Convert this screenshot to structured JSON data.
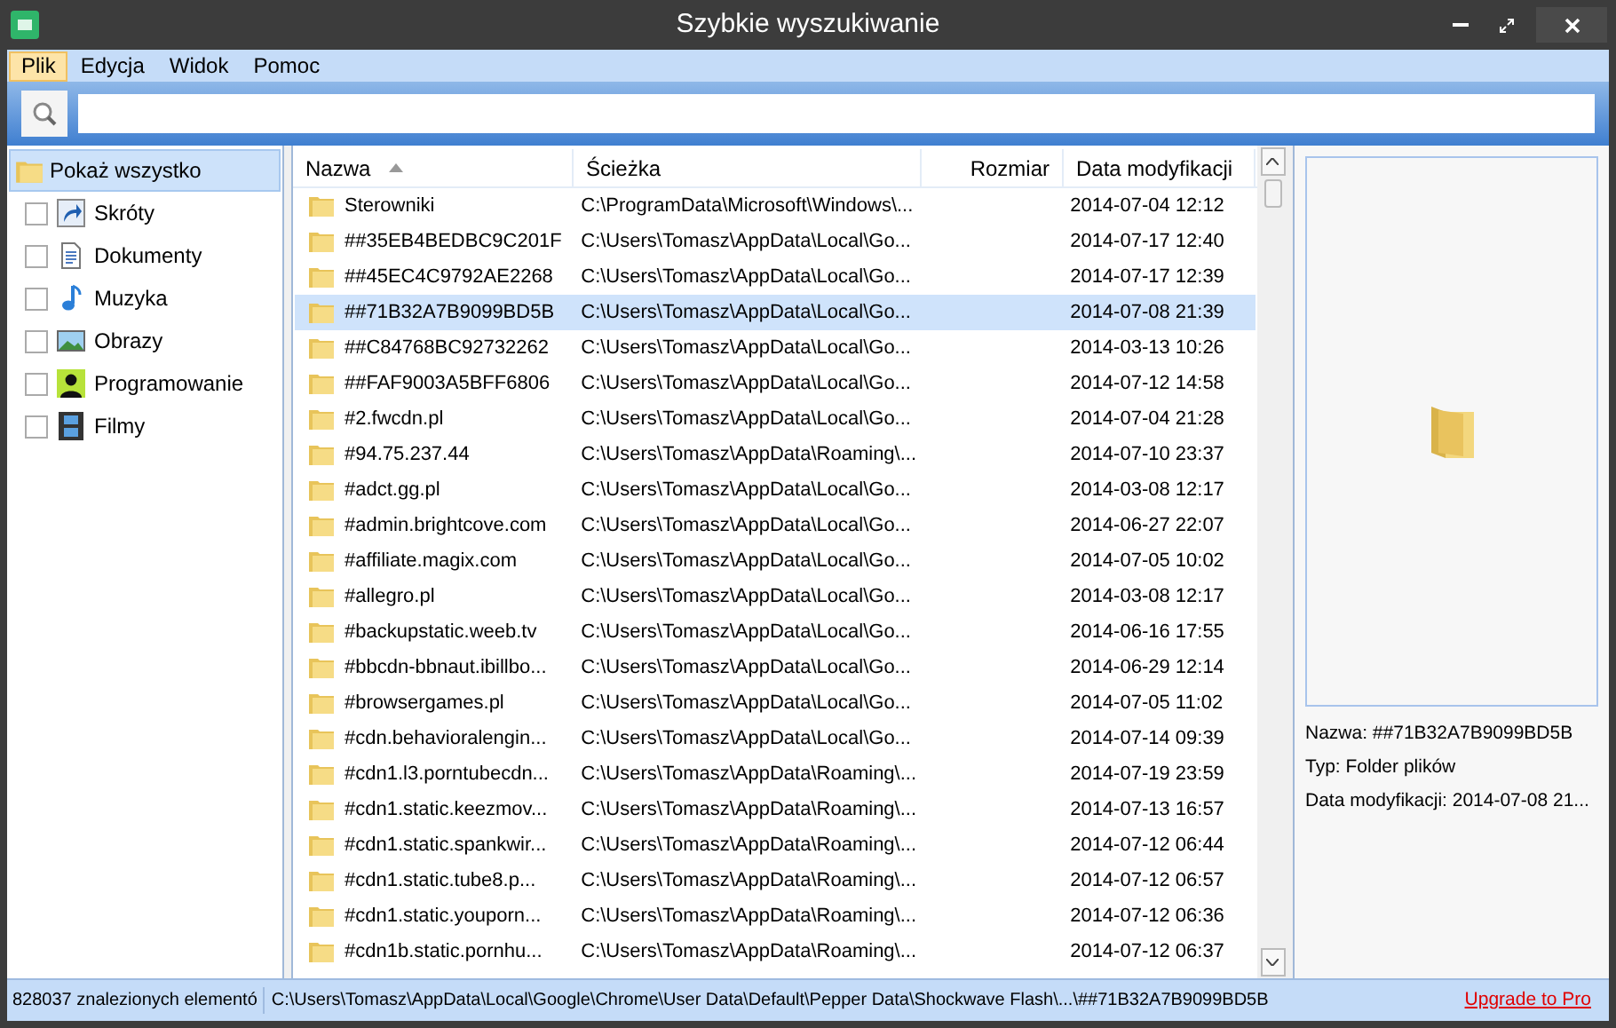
{
  "window": {
    "title": "Szybkie wyszukiwanie"
  },
  "menu": [
    {
      "label": "Plik",
      "selected": true
    },
    {
      "label": "Edycja",
      "selected": false
    },
    {
      "label": "Widok",
      "selected": false
    },
    {
      "label": "Pomoc",
      "selected": false
    }
  ],
  "sidebar": {
    "show_all": {
      "label": "Pokaż wszystko",
      "selected": true
    },
    "filters": [
      {
        "label": "Skróty",
        "checked": false
      },
      {
        "label": "Dokumenty",
        "checked": false
      },
      {
        "label": "Muzyka",
        "checked": false
      },
      {
        "label": "Obrazy",
        "checked": false
      },
      {
        "label": "Programowanie",
        "checked": false
      },
      {
        "label": "Filmy",
        "checked": false
      }
    ]
  },
  "table": {
    "columns": [
      "Nazwa",
      "Ścieżka",
      "Rozmiar",
      "Data modyfikacji"
    ],
    "rows": [
      {
        "name": "Sterowniki",
        "path": "C:\\ProgramData\\Microsoft\\Windows\\...",
        "date": "2014-07-04 12:12",
        "selected": false
      },
      {
        "name": "##35EB4BEDBC9C201F",
        "path": "C:\\Users\\Tomasz\\AppData\\Local\\Go...",
        "date": "2014-07-17 12:40",
        "selected": false
      },
      {
        "name": "##45EC4C9792AE2268",
        "path": "C:\\Users\\Tomasz\\AppData\\Local\\Go...",
        "date": "2014-07-17 12:39",
        "selected": false
      },
      {
        "name": "##71B32A7B9099BD5B",
        "path": "C:\\Users\\Tomasz\\AppData\\Local\\Go...",
        "date": "2014-07-08 21:39",
        "selected": true
      },
      {
        "name": "##C84768BC92732262",
        "path": "C:\\Users\\Tomasz\\AppData\\Local\\Go...",
        "date": "2014-03-13 10:26",
        "selected": false
      },
      {
        "name": "##FAF9003A5BFF6806",
        "path": "C:\\Users\\Tomasz\\AppData\\Local\\Go...",
        "date": "2014-07-12 14:58",
        "selected": false
      },
      {
        "name": "#2.fwcdn.pl",
        "path": "C:\\Users\\Tomasz\\AppData\\Local\\Go...",
        "date": "2014-07-04 21:28",
        "selected": false
      },
      {
        "name": "#94.75.237.44",
        "path": "C:\\Users\\Tomasz\\AppData\\Roaming\\...",
        "date": "2014-07-10 23:37",
        "selected": false
      },
      {
        "name": "#adct.gg.pl",
        "path": "C:\\Users\\Tomasz\\AppData\\Local\\Go...",
        "date": "2014-03-08 12:17",
        "selected": false
      },
      {
        "name": "#admin.brightcove.com",
        "path": "C:\\Users\\Tomasz\\AppData\\Local\\Go...",
        "date": "2014-06-27 22:07",
        "selected": false
      },
      {
        "name": "#affiliate.magix.com",
        "path": "C:\\Users\\Tomasz\\AppData\\Local\\Go...",
        "date": "2014-07-05 10:02",
        "selected": false
      },
      {
        "name": "#allegro.pl",
        "path": "C:\\Users\\Tomasz\\AppData\\Local\\Go...",
        "date": "2014-03-08 12:17",
        "selected": false
      },
      {
        "name": "#backupstatic.weeb.tv",
        "path": "C:\\Users\\Tomasz\\AppData\\Local\\Go...",
        "date": "2014-06-16 17:55",
        "selected": false
      },
      {
        "name": "#bbcdn-bbnaut.ibillbo...",
        "path": "C:\\Users\\Tomasz\\AppData\\Local\\Go...",
        "date": "2014-06-29 12:14",
        "selected": false
      },
      {
        "name": "#browsergames.pl",
        "path": "C:\\Users\\Tomasz\\AppData\\Local\\Go...",
        "date": "2014-07-05 11:02",
        "selected": false
      },
      {
        "name": "#cdn.behavioralengin...",
        "path": "C:\\Users\\Tomasz\\AppData\\Local\\Go...",
        "date": "2014-07-14 09:39",
        "selected": false
      },
      {
        "name": "#cdn1.l3.porntubecdn...",
        "path": "C:\\Users\\Tomasz\\AppData\\Roaming\\...",
        "date": "2014-07-19 23:59",
        "selected": false
      },
      {
        "name": "#cdn1.static.keezmov...",
        "path": "C:\\Users\\Tomasz\\AppData\\Roaming\\...",
        "date": "2014-07-13 16:57",
        "selected": false
      },
      {
        "name": "#cdn1.static.spankwir...",
        "path": "C:\\Users\\Tomasz\\AppData\\Roaming\\...",
        "date": "2014-07-12 06:44",
        "selected": false
      },
      {
        "name": "#cdn1.static.tube8.p...",
        "path": "C:\\Users\\Tomasz\\AppData\\Roaming\\...",
        "date": "2014-07-12 06:57",
        "selected": false
      },
      {
        "name": "#cdn1.static.youporn...",
        "path": "C:\\Users\\Tomasz\\AppData\\Roaming\\...",
        "date": "2014-07-12 06:36",
        "selected": false
      },
      {
        "name": "#cdn1b.static.pornhu...",
        "path": "C:\\Users\\Tomasz\\AppData\\Roaming\\...",
        "date": "2014-07-12 06:37",
        "selected": false
      }
    ]
  },
  "preview": {
    "details": [
      "Nazwa: ##71B32A7B9099BD5B",
      "Typ: Folder plików",
      "Data modyfikacji: 2014-07-08 21..."
    ]
  },
  "status_bar": {
    "count": "828037 znalezionych elementó",
    "path": "C:\\Users\\Tomasz\\AppData\\Local\\Google\\Chrome\\User Data\\Default\\Pepper Data\\Shockwave Flash\\...\\##71B32A7B9099BD5B",
    "link": "Upgrade to Pro"
  }
}
